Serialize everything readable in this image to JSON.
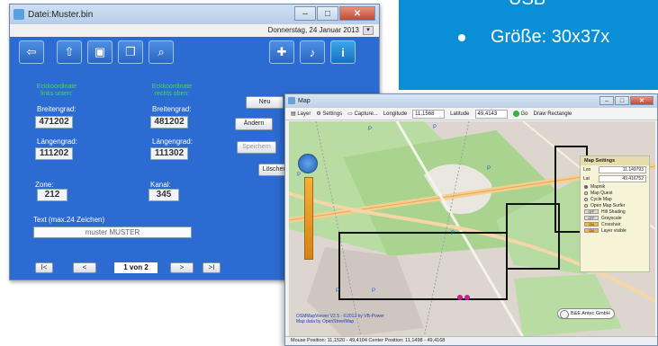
{
  "slide": {
    "top_text": "USB",
    "bullet_text": "Größe: 30x37x"
  },
  "main_window": {
    "title": "Datei:Muster.bin",
    "date": "Donnerstag, 24    Januar   2013",
    "labels": {
      "corner_lower_left": "Eckkoordinate\nlinks unten:",
      "corner_upper_right": "Eckkoordinate\nrechts oben:",
      "latitude_left": "Breitengrad:",
      "latitude_right": "Breitengrad:",
      "longitude_left": "Längengrad:",
      "longitude_right": "Längengrad:",
      "zone": "Zone:",
      "channel": "Kanal:",
      "text_hint": "Text (max.24 Zeichen)"
    },
    "values": {
      "lat_left": "471202",
      "lat_right": "481202",
      "lon_left": "111202",
      "lon_right": "111302",
      "zone": "212",
      "channel": "345",
      "text": "muster   MUSTER"
    },
    "buttons": {
      "new": "Neu",
      "change": "Ändern",
      "save": "Speichern",
      "delete": "Löschen"
    },
    "nav": {
      "first": "I<",
      "prev": "<",
      "page": "1 von 2",
      "next": ">",
      "last": ">I"
    }
  },
  "map_window": {
    "title": "Map",
    "toolbar": {
      "layer": "Layer",
      "settings": "Settings",
      "capture": "Capture...",
      "longitude_label": "Longitude",
      "longitude_value": "11,1568",
      "latitude_label": "Latitude",
      "latitude_value": "49,4143",
      "go": "Go",
      "draw": "Draw Rectangle"
    },
    "settings_panel": {
      "title": "Map Settings",
      "lon_label": "Lon",
      "lon_value": "11.149793",
      "lat_label": "Lat",
      "lat_value": "49.416752",
      "sources": [
        "Mapnik",
        "Map Quest",
        "Cycle Map",
        "Open Map Surfer"
      ],
      "options": [
        {
          "state": "OFF",
          "label": "Hill Shading"
        },
        {
          "state": "OFF",
          "label": "Grayscale"
        },
        {
          "state": "ON",
          "label": "Crosshair"
        },
        {
          "state": "ON",
          "label": "Layer visible"
        }
      ]
    },
    "marker_label": "B&E Antec GmbH",
    "copyright_1": "OSMMapViewer V2.5 - ©2012 by VB-Power",
    "copyright_2": "Map data by OpenStreetMap",
    "status": "Mouse Position: 11,1520 - 49,4104    Center Position: 11,1498 - 49,4168"
  }
}
